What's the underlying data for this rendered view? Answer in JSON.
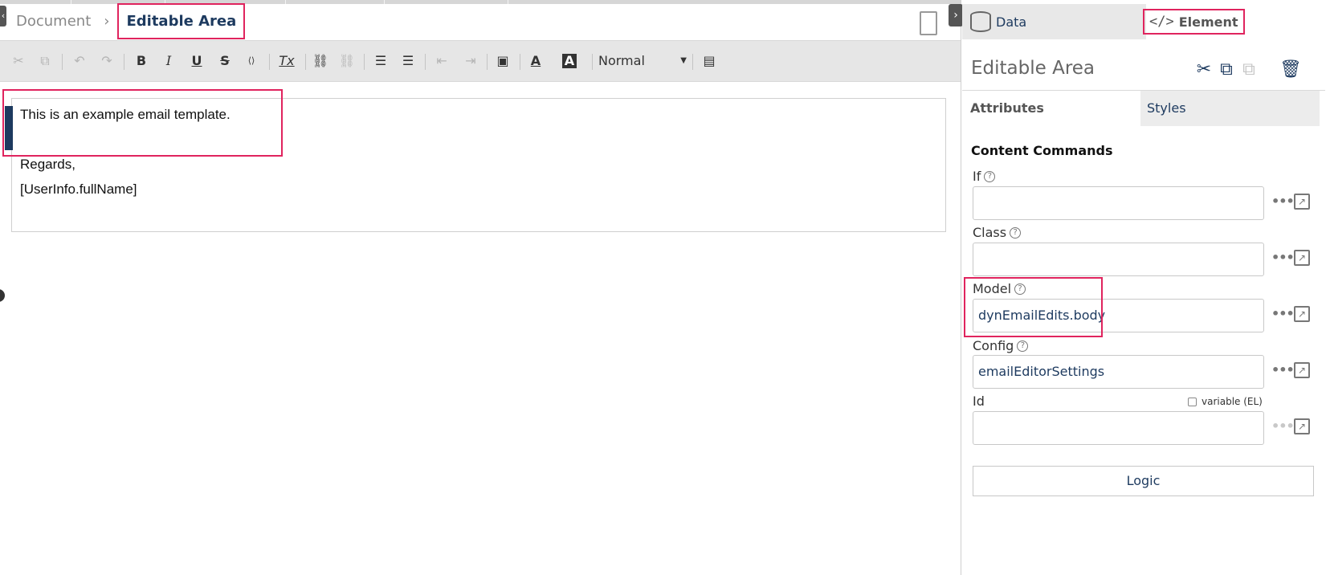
{
  "breadcrumb": {
    "root": "Document",
    "separator": "›",
    "current": "Editable Area"
  },
  "toolbar": {
    "buttons": [
      {
        "name": "cut-icon",
        "glyph": "✂",
        "disabled": true
      },
      {
        "name": "copy-icon",
        "glyph": "⧉",
        "disabled": true
      },
      {
        "name": "undo-icon",
        "glyph": "↶",
        "disabled": true
      },
      {
        "name": "redo-icon",
        "glyph": "↷",
        "disabled": true
      },
      {
        "name": "bold-icon",
        "glyph": "B"
      },
      {
        "name": "italic-icon",
        "glyph": "I"
      },
      {
        "name": "underline-icon",
        "glyph": "U"
      },
      {
        "name": "strikethrough-icon",
        "glyph": "S"
      },
      {
        "name": "source-icon",
        "glyph": "⟨⟩"
      },
      {
        "name": "remove-format-icon",
        "glyph": "Tx"
      },
      {
        "name": "link-icon",
        "glyph": "⛓"
      },
      {
        "name": "unlink-icon",
        "glyph": "⛓",
        "disabled": true
      },
      {
        "name": "numbered-list-icon",
        "glyph": "☰"
      },
      {
        "name": "bulleted-list-icon",
        "glyph": "☰"
      },
      {
        "name": "outdent-icon",
        "glyph": "⇤",
        "disabled": true
      },
      {
        "name": "indent-icon",
        "glyph": "⇥",
        "disabled": true
      },
      {
        "name": "image-icon",
        "glyph": "▣"
      },
      {
        "name": "text-color-icon",
        "glyph": "A"
      },
      {
        "name": "background-color-icon",
        "glyph": "A"
      },
      {
        "name": "show-blocks-icon",
        "glyph": "▤"
      }
    ],
    "format_value": "Normal"
  },
  "editor": {
    "lines": [
      "This is an example email template.",
      "Regards,",
      "[UserInfo.fullName]"
    ]
  },
  "panel": {
    "tabs": {
      "data": "Data",
      "element": "Element"
    },
    "code_glyph": "</>",
    "title": "Editable Area",
    "subtabs": {
      "attributes": "Attributes",
      "styles": "Styles"
    },
    "section": "Content Commands",
    "help_glyph": "?",
    "more_glyph": "•••",
    "fields": [
      {
        "label": "If",
        "value": ""
      },
      {
        "label": "Class",
        "value": ""
      },
      {
        "label": "Model",
        "value": "dynEmailEdits.body"
      },
      {
        "label": "Config",
        "value": "emailEditorSettings"
      },
      {
        "label": "Id",
        "value": ""
      }
    ],
    "variable_label": "variable (EL)",
    "logic_button": "Logic"
  },
  "colors": {
    "accent": "#1d3a5f",
    "highlight": "#e0245e",
    "toolbar_bg": "#e6e6e6"
  }
}
